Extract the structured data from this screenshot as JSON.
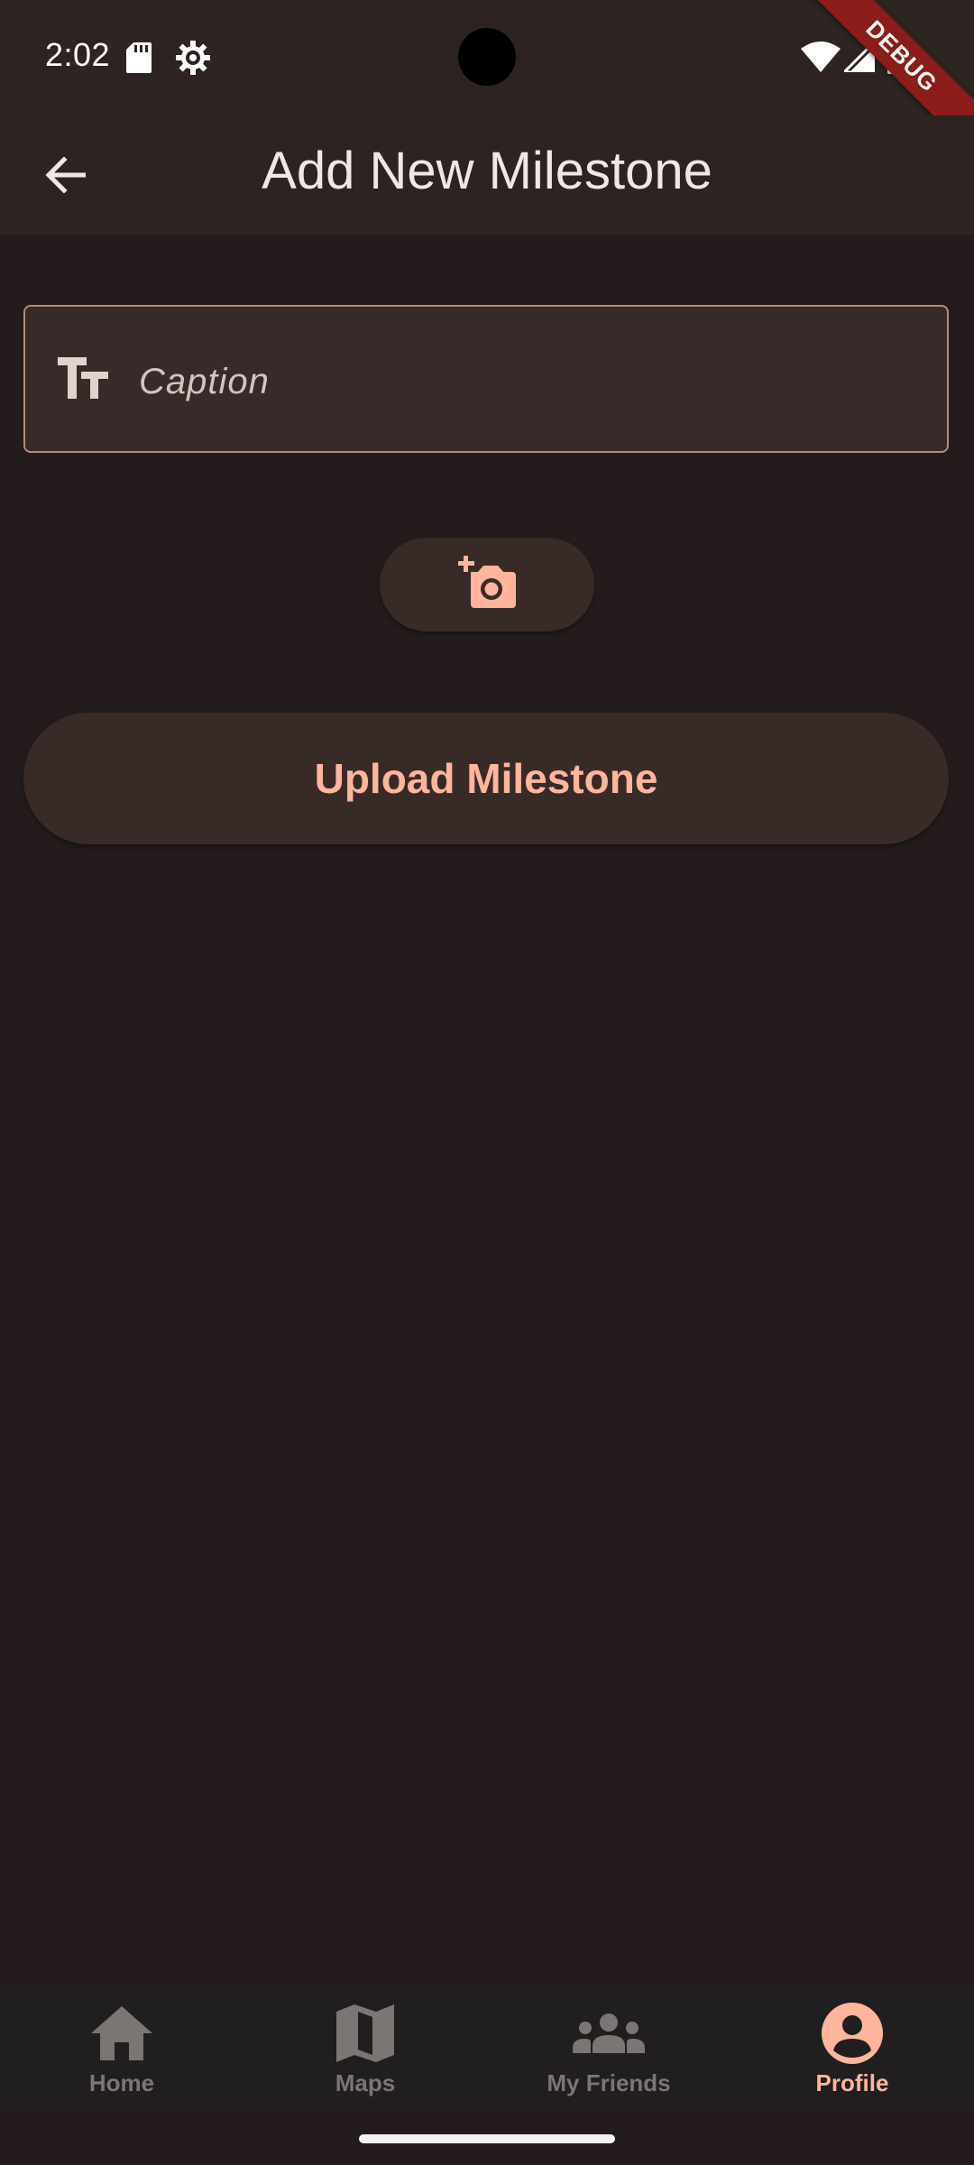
{
  "status_bar": {
    "time": "2:02",
    "debug_label": "DEBUG",
    "icons": [
      "sd-card-icon",
      "gear-icon",
      "wifi-icon",
      "signal-icon",
      "battery-icon"
    ]
  },
  "app_bar": {
    "title": "Add New Milestone",
    "back_icon": "arrow-back-icon"
  },
  "form": {
    "caption": {
      "placeholder": "Caption",
      "value": "",
      "icon": "text-fields-icon"
    },
    "add_photo": {
      "icon": "add-a-photo-icon"
    },
    "upload_label": "Upload Milestone"
  },
  "bottom_nav": {
    "items": [
      {
        "label": "Home",
        "icon": "home-icon",
        "active": false
      },
      {
        "label": "Maps",
        "icon": "map-icon",
        "active": false
      },
      {
        "label": "My Friends",
        "icon": "people-icon",
        "active": false
      },
      {
        "label": "Profile",
        "icon": "account-circle-icon",
        "active": true
      }
    ]
  },
  "colors": {
    "background": "#241c1c",
    "app_bar": "#2d2321",
    "accent": "#ffb59d",
    "field_border": "#b78a7a",
    "inactive_nav": "#7b7573",
    "debug_banner": "#8b1c1c"
  }
}
